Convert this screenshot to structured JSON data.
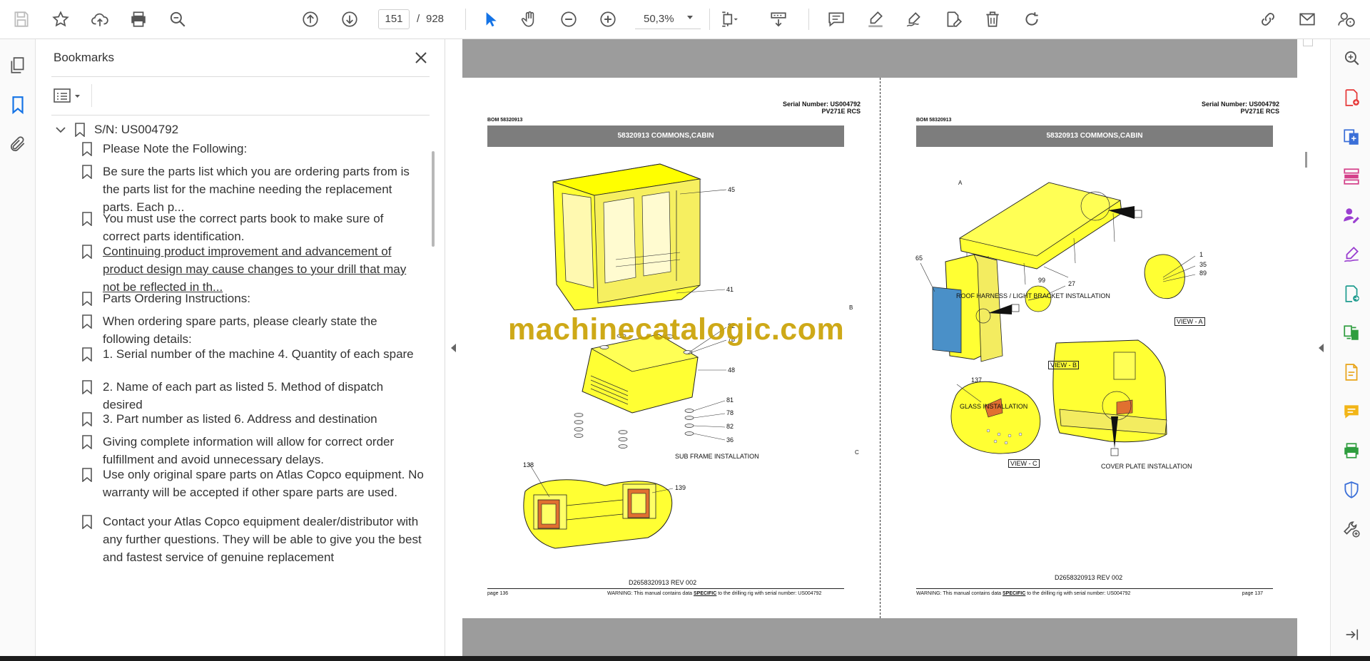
{
  "toolbar": {
    "current_page": "151",
    "page_separator": "/",
    "total_pages": "928",
    "zoom": "50,3%"
  },
  "bookmarks": {
    "title": "Bookmarks",
    "root_label": "S/N: US004792",
    "items": [
      {
        "label": "Please Note the Following:"
      },
      {
        "label": "Be sure the parts list which you are ordering parts from is the parts list for the machine needing the replacement parts. Each p..."
      },
      {
        "label": "You must use the correct parts book to make sure of correct parts identification."
      },
      {
        "label": "Continuing product improvement and advancement of product design may cause changes to your drill that may not be reflected in th..."
      },
      {
        "label": "Parts Ordering Instructions:"
      },
      {
        "label": "When ordering spare parts, please clearly state the following details:"
      },
      {
        "label": "1. Serial number of the machine 4. Quantity of each spare"
      },
      {
        "label": "2. Name of each part as listed 5. Method of dispatch desired"
      },
      {
        "label": "3. Part number as listed 6. Address and destination"
      },
      {
        "label": "Giving complete information will allow for correct order fulfillment and avoid unnecessary delays."
      },
      {
        "label": "Use only original spare parts on Atlas Copco equipment. No warranty will be accepted if other spare parts are used."
      },
      {
        "label": "Contact your Atlas Copco equipment dealer/distributor with any further questions. They will be able to give you the best and fastest service of genuine replacement"
      }
    ]
  },
  "document": {
    "watermark": "machinecatalogic.com",
    "left_page": {
      "serial_line1": "Serial Number: US004792",
      "serial_line2": "PV271E RCS",
      "bom": "BOM 58320913",
      "banner": "58320913 COMMONS,CABIN",
      "caption_subframe": "SUB FRAME INSTALLATION",
      "rev": "D2658320913 REV 002",
      "page_label": "page 136",
      "warning_prefix": "WARNING:  This manual contains data ",
      "warning_bold": "SPECIFIC",
      "warning_suffix": " to the drilling rig with serial number: US004792",
      "callouts": [
        "45",
        "41",
        "82",
        "78",
        "48",
        "81",
        "78",
        "82",
        "36",
        "138",
        "139"
      ]
    },
    "right_page": {
      "serial_line1": "Serial Number: US004792",
      "serial_line2": "PV271E RCS",
      "bom": "BOM 58320913",
      "banner": "58320913 COMMONS,CABIN",
      "caption_roof": "ROOF HARNESS / LIGHT BRACKET  INSTALLATION",
      "caption_view_a": "VIEW - A",
      "caption_view_b": "VIEW - B",
      "caption_view_c": "VIEW - C",
      "caption_glass": "GLASS  INSTALLATION",
      "caption_cover": "COVER PLATE  INSTALLATION",
      "rev": "D2658320913 REV 002",
      "page_label": "page 137",
      "warning_prefix": "WARNING:  This manual contains data ",
      "warning_bold": "SPECIFIC",
      "warning_suffix": " to the drilling rig with serial number: US004792",
      "callouts": [
        "A",
        "99",
        "1",
        "35",
        "89",
        "65",
        "B",
        "27",
        "137",
        "C"
      ]
    }
  },
  "colors": {
    "accent_blue": "#1473e6",
    "part_yellow": "#ffff00",
    "watermark_gold": "#c9a000",
    "banner_gray": "#7d7d7d",
    "glass_blue": "#4a90c8"
  }
}
